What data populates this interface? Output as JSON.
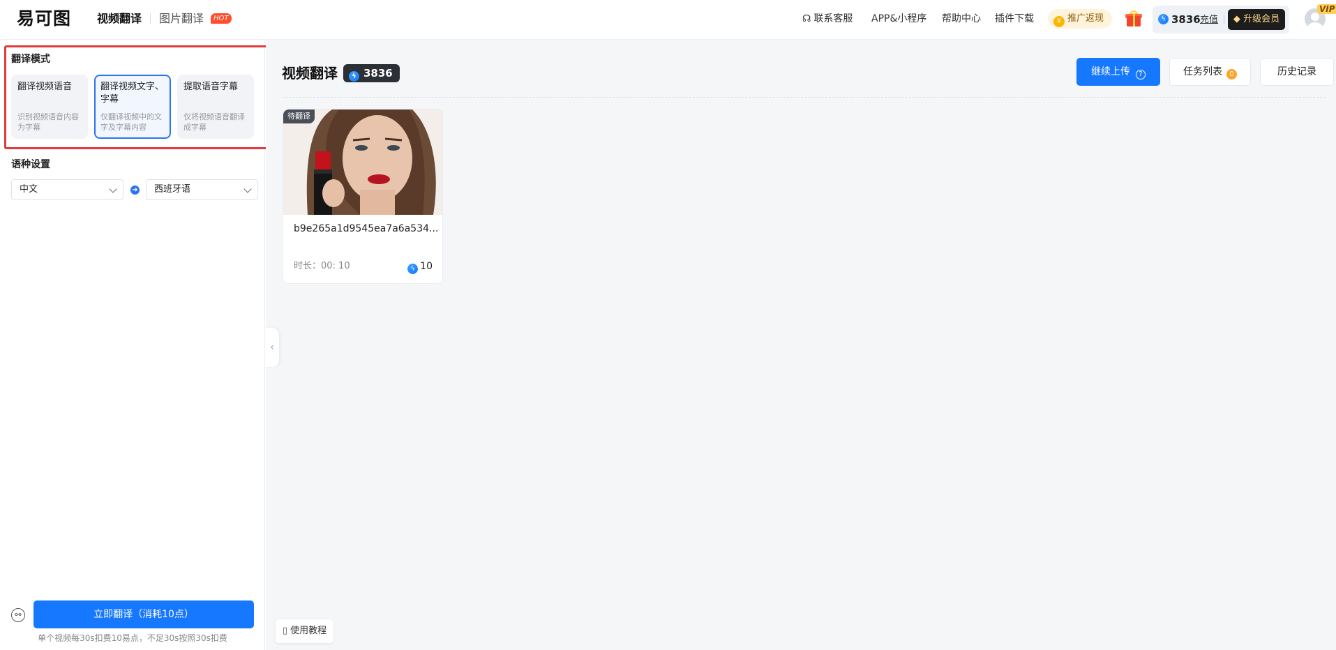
{
  "header": {
    "logo": "易可图",
    "tabs": [
      {
        "label": "视频翻译"
      },
      {
        "label": "图片翻译",
        "badge": "HOT"
      }
    ],
    "links": {
      "service": "联系客服",
      "app": "APP&小程序",
      "help": "帮助中心",
      "plugin": "插件下载"
    },
    "promo": "推广返现",
    "balance": "3836",
    "recharge": "充值",
    "upgrade": "升级会员",
    "vip": "VIP"
  },
  "sidebar": {
    "mode_title": "翻译模式",
    "modes": [
      {
        "title": "翻译视频语音",
        "desc": "识别视频语音内容为字幕"
      },
      {
        "title": "翻译视频文字、字幕",
        "desc": "仅翻译视频中的文字及字幕内容"
      },
      {
        "title": "提取语音字幕",
        "desc": "仅将视频语音翻译成字幕"
      }
    ],
    "lang_title": "语种设置",
    "source_lang": "中文",
    "target_lang": "西班牙语",
    "translate_button": "立即翻译（消耗10点）",
    "note": "单个视频每30s扣费10易点，不足30s按照30s扣费"
  },
  "main": {
    "title": "视频翻译",
    "balance": "3836",
    "upload_button": "继续上传",
    "task_list": "任务列表",
    "task_count": "0",
    "history": "历史记录",
    "card": {
      "status": "待翻译",
      "name": "b9e265a1d9545ea7a6a534...",
      "duration": "时长：00: 10",
      "cost": "10"
    },
    "tutorial": "使用教程"
  },
  "colors": {
    "accent": "#1677ff",
    "highlight_border": "#e23b3b",
    "hot": "#ff4d2e"
  }
}
